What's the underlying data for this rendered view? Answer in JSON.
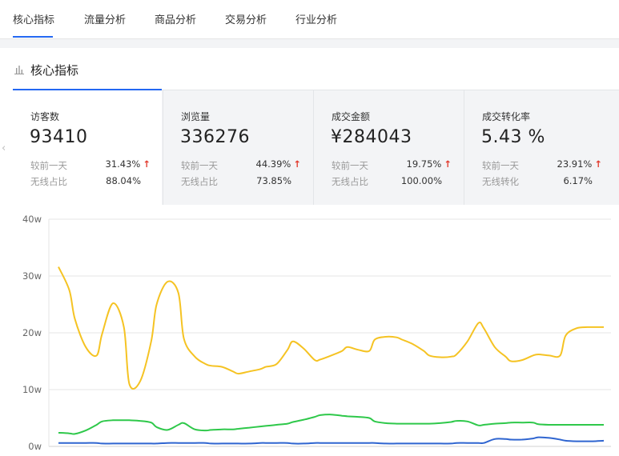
{
  "tabs": [
    {
      "label": "核心指标",
      "active": true
    },
    {
      "label": "流量分析",
      "active": false
    },
    {
      "label": "商品分析",
      "active": false
    },
    {
      "label": "交易分析",
      "active": false
    },
    {
      "label": "行业分析",
      "active": false
    }
  ],
  "section": {
    "title": "核心指标",
    "icon": "bar-chart-icon"
  },
  "cards": [
    {
      "name": "访客数",
      "value": "93410",
      "compare_label": "较前一天",
      "compare_value": "31.43%",
      "share_label": "无线占比",
      "share_value": "88.04%",
      "trend": "up",
      "active": true
    },
    {
      "name": "浏览量",
      "value": "336276",
      "compare_label": "较前一天",
      "compare_value": "44.39%",
      "share_label": "无线占比",
      "share_value": "73.85%",
      "trend": "up",
      "active": false
    },
    {
      "name": "成交金额",
      "value": "¥284043",
      "compare_label": "较前一天",
      "compare_value": "19.75%",
      "share_label": "无线占比",
      "share_value": "100.00%",
      "trend": "up",
      "active": false
    },
    {
      "name": "成交转化率",
      "value": "5.43 %",
      "compare_label": "较前一天",
      "compare_value": "23.91%",
      "share_label": "无线转化",
      "share_value": "6.17%",
      "trend": "up",
      "active": false
    }
  ],
  "colors": {
    "accent": "#2468f2",
    "up_arrow": "#e23b2e",
    "series_yellow": "#f5c323",
    "series_green": "#2ec84a",
    "series_blue": "#2f65d0"
  },
  "chart_data": {
    "type": "line",
    "ylim": [
      0,
      40
    ],
    "y_ticks": [
      "0w",
      "10w",
      "20w",
      "30w",
      "40w"
    ],
    "grid": true,
    "x": [
      0,
      1,
      2,
      3,
      4,
      5,
      6,
      7,
      8,
      9,
      10,
      11,
      12,
      13,
      14,
      15,
      16,
      17,
      18,
      19,
      20,
      21,
      22,
      23,
      24,
      25,
      26,
      27,
      28,
      29,
      30,
      31,
      32,
      33,
      34,
      35,
      36,
      37,
      38,
      39,
      40,
      41,
      42,
      43,
      44,
      45,
      46,
      47,
      48,
      49,
      50,
      51,
      52,
      53,
      54,
      55,
      56,
      57,
      58,
      59,
      60,
      61,
      62,
      63,
      64,
      65,
      66,
      67,
      68,
      69,
      70,
      71,
      72,
      73,
      74,
      75,
      76,
      77,
      78,
      79,
      80,
      81,
      82,
      83,
      84,
      85,
      86,
      87,
      88,
      89,
      90,
      91,
      92,
      93,
      94,
      95,
      96,
      97,
      98,
      99,
      100
    ],
    "series": [
      {
        "color": "#f5c323",
        "values": [
          31.6,
          27.5,
          22.5,
          17.5,
          16.0,
          19.8,
          25.2,
          21.0,
          11.0,
          11.5,
          18.5,
          25.0,
          29.0,
          27.0,
          19.0,
          15.8,
          14.5,
          14.2,
          14.0,
          13.2,
          12.8,
          13.2,
          13.6,
          14.0,
          14.5,
          17.0,
          18.5,
          17.2,
          15.2,
          15.3,
          16.0,
          16.8,
          17.5,
          17.0,
          16.8,
          18.8,
          19.3,
          19.2,
          18.8,
          18.0,
          16.8,
          16.0,
          15.7,
          15.8,
          16.2,
          18.5,
          21.7,
          20.8,
          17.5,
          15.8,
          15.0,
          15.2,
          16.0,
          16.2,
          16.0,
          16.0,
          19.5,
          20.8,
          21.0,
          21.0,
          21.0
        ]
      },
      {
        "color": "#2ec84a",
        "values": [
          2.4,
          2.3,
          2.2,
          2.8,
          3.8,
          4.4,
          4.6,
          4.6,
          4.6,
          4.5,
          4.2,
          3.4,
          2.9,
          3.8,
          4.1,
          3.0,
          2.8,
          2.9,
          3.0,
          3.0,
          3.1,
          3.3,
          3.5,
          3.6,
          3.8,
          4.0,
          4.3,
          4.7,
          5.2,
          5.5,
          5.6,
          5.4,
          5.3,
          5.2,
          5.0,
          4.4,
          4.1,
          4.0,
          4.0,
          4.0,
          4.0,
          4.0,
          4.1,
          4.3,
          4.5,
          4.4,
          3.7,
          3.8,
          4.0,
          4.1,
          4.2,
          4.2,
          4.2,
          3.9,
          3.8,
          3.8,
          3.8,
          3.8,
          3.8,
          3.8,
          3.8
        ]
      },
      {
        "color": "#2f65d0",
        "values": [
          0.6,
          0.6,
          0.6,
          0.6,
          0.6,
          0.5,
          0.5,
          0.5,
          0.5,
          0.5,
          0.5,
          0.5,
          0.6,
          0.6,
          0.6,
          0.6,
          0.6,
          0.5,
          0.5,
          0.5,
          0.5,
          0.5,
          0.6,
          0.6,
          0.6,
          0.6,
          0.5,
          0.5,
          0.6,
          0.6,
          0.6,
          0.6,
          0.6,
          0.6,
          0.6,
          0.6,
          0.5,
          0.5,
          0.5,
          0.5,
          0.5,
          0.5,
          0.5,
          0.5,
          0.6,
          0.6,
          0.6,
          0.6,
          1.3,
          1.3,
          1.2,
          1.2,
          1.4,
          1.6,
          1.5,
          1.2,
          1.0,
          0.9,
          0.9,
          0.9,
          1.0
        ]
      }
    ]
  }
}
